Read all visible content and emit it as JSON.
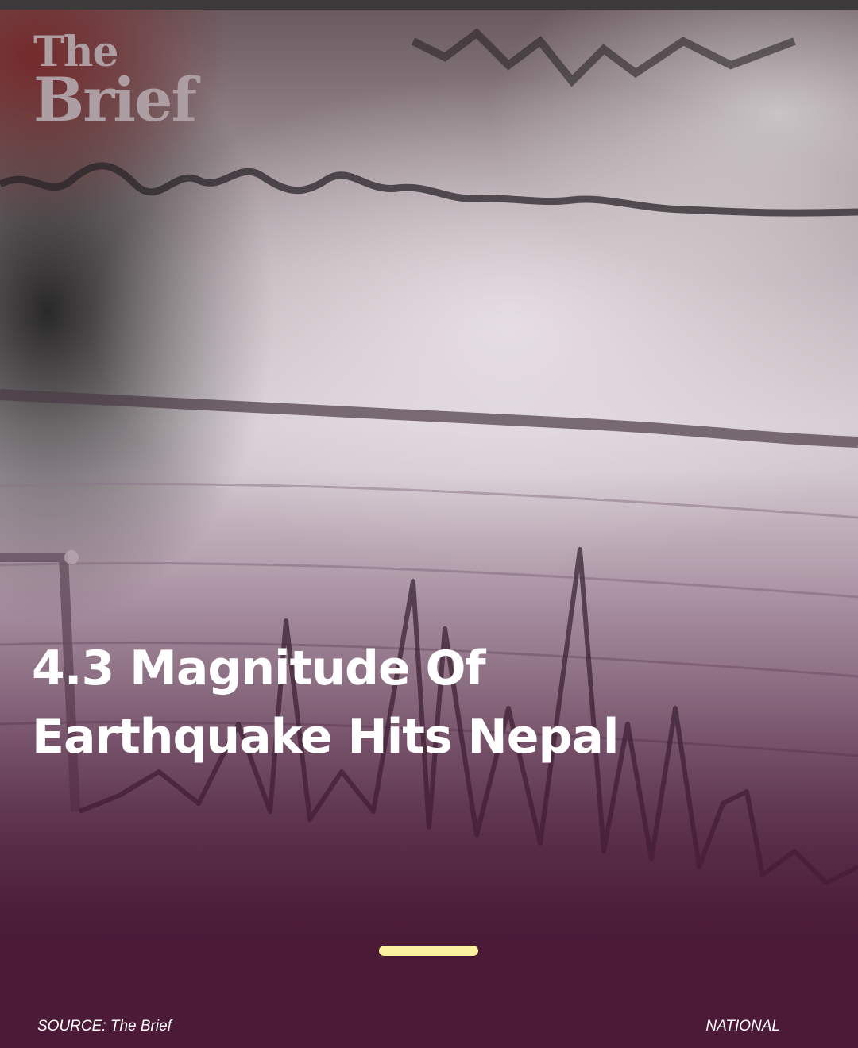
{
  "brand": {
    "line1": "The",
    "line2": "Brief",
    "logo_color": "#ad9ea3"
  },
  "headline": "4.3 Magnitude Of Earthquake Hits Nepal",
  "footer": {
    "source": "SOURCE: The Brief",
    "category": "NATIONAL"
  },
  "colors": {
    "background": "#4a1a37",
    "progress_indicator": "#fcf1a1",
    "text": "#ffffff"
  }
}
